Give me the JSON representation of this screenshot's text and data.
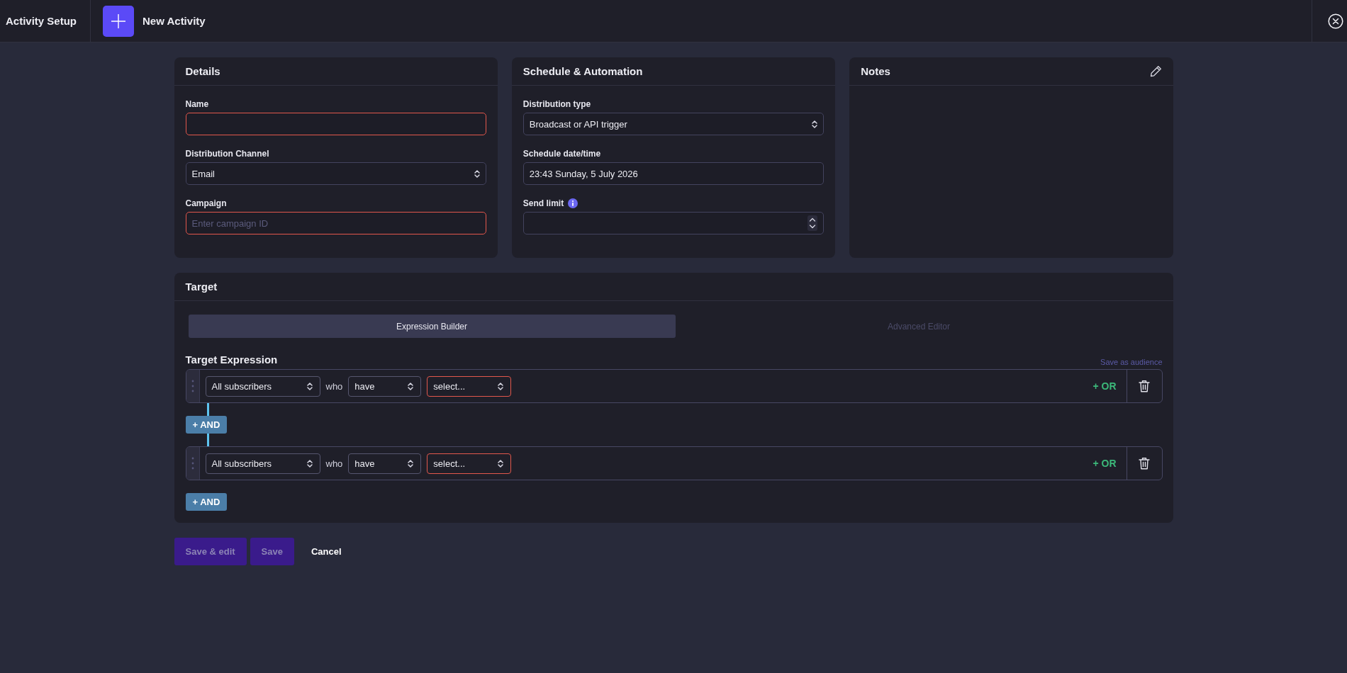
{
  "top_bar": {
    "title": "Activity Setup",
    "page_title": "New Activity"
  },
  "details": {
    "title": "Details",
    "fields": [
      {
        "kind": "input",
        "label": "Name",
        "invalid": true,
        "info": false
      },
      {
        "kind": "select",
        "label": "Distribution Channel",
        "value": "Email",
        "invalid": false,
        "info": false
      },
      {
        "kind": "input",
        "label": "Campaign",
        "placeholder": "Enter campaign ID",
        "invalid": true,
        "info": false
      }
    ]
  },
  "schedule": {
    "title": "Schedule & Automation",
    "fields": [
      {
        "kind": "select",
        "label": "Distribution type",
        "value": "Broadcast or API trigger",
        "invalid": false,
        "info": false
      },
      {
        "kind": "input",
        "label": "Schedule date/time",
        "value": "23:43 Sunday, 5 July 2026",
        "invalid": false,
        "info": false
      },
      {
        "kind": "number",
        "label": "Send limit",
        "invalid": false,
        "info": true
      }
    ]
  },
  "notes": {
    "title": "Notes"
  },
  "target": {
    "title": "Target",
    "tabs": [
      {
        "label": "Expression Builder",
        "selected": true
      },
      {
        "label": "Advanced Editor",
        "selected": false
      }
    ],
    "expression_title": "Target Expression",
    "save_link": "Save as audience",
    "rules": [
      {
        "subject": "All subscribers",
        "connector": "who",
        "verb": "have",
        "condition": "select...",
        "condition_invalid": true,
        "or_label": "+ OR",
        "and_label": "+ AND"
      },
      {
        "subject": "All subscribers",
        "connector": "who",
        "verb": "have",
        "condition": "select...",
        "condition_invalid": true,
        "or_label": "+ OR",
        "and_label": "+ AND"
      }
    ]
  },
  "actions": [
    {
      "kind": "primary",
      "label": "Save & edit",
      "disabled": true
    },
    {
      "kind": "primary",
      "label": "Save",
      "disabled": true
    },
    {
      "kind": "plain",
      "label": "Cancel",
      "disabled": false
    }
  ]
}
